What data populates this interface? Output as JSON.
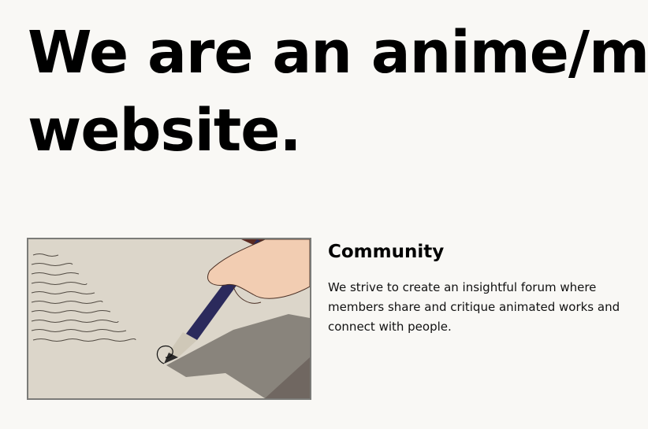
{
  "hero": {
    "line1": "We are an anime/m",
    "line2": "website."
  },
  "feature": {
    "image_alt": "drawing-of-hand-writing-with-fountain-pen",
    "title": "Community",
    "description": "We strive to create an insightful forum where members share and critique animated works and connect with people."
  },
  "colors": {
    "background": "#f9f8f5",
    "text": "#000000",
    "image_border": "#7b7b78"
  }
}
